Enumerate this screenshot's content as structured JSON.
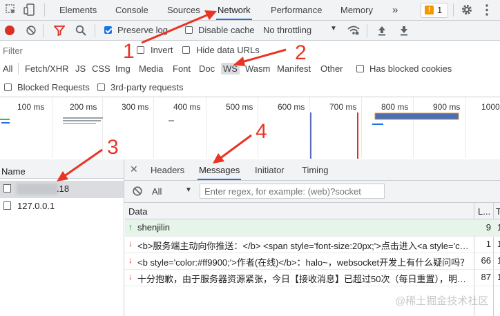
{
  "tabs": [
    "Elements",
    "Console",
    "Sources",
    "Network",
    "Performance",
    "Memory"
  ],
  "more_tabs": "»",
  "warning_count": "1",
  "toolbar": {
    "preserve_log": "Preserve log",
    "disable_cache": "Disable cache",
    "throttling": "No throttling",
    "throttling_arrow": "▼"
  },
  "filter": {
    "placeholder": "Filter",
    "invert": "Invert",
    "hide_data_urls": "Hide data URLs"
  },
  "types": [
    "All",
    "Fetch/XHR",
    "JS",
    "CSS",
    "Img",
    "Media",
    "Font",
    "Doc",
    "WS",
    "Wasm",
    "Manifest",
    "Other"
  ],
  "has_blocked_cookies": "Has blocked cookies",
  "blocked_requests": "Blocked Requests",
  "third_party": "3rd-party requests",
  "timeline_ticks": [
    "100 ms",
    "200 ms",
    "300 ms",
    "400 ms",
    "500 ms",
    "600 ms",
    "700 ms",
    "800 ms",
    "900 ms",
    "1000"
  ],
  "requests": {
    "header": "Name",
    "items": [
      ".18",
      "127.0.0.1"
    ]
  },
  "detail_tabs": [
    "Headers",
    "Messages",
    "Initiator",
    "Timing"
  ],
  "messages_filter": {
    "option": "All",
    "arrow": "▼",
    "placeholder": "Enter regex, for example: (web)?socket"
  },
  "messages_table": {
    "headers": [
      "Data",
      "L...",
      "T"
    ],
    "rows": [
      {
        "dir": "↑",
        "data": "shenjilin",
        "len": "9",
        "t": "1"
      },
      {
        "dir": "↓",
        "data": "<b>服务端主动向你推送：</b> <span style='font-size:20px;'>点击进入<a style='color:#ff9900'>",
        "len": "1",
        "t": "1"
      },
      {
        "dir": "↓",
        "data": "<b style='color:#ff9900;'>作者(在线)</b>：halo~，websocket开发上有什么疑问吗？",
        "len": "66",
        "t": "1"
      },
      {
        "dir": "↓",
        "data": "十分抱歉，由于服务器资源紧张，今日【接收消息】已超过50次（每日重置），明日再来吧",
        "len": "87",
        "t": "1"
      }
    ]
  },
  "annotations": [
    "1",
    "2",
    "3",
    "4"
  ],
  "watermark": "@稀土掘金技术社区",
  "colors": {
    "accent": "#1a73e8",
    "record": "#d93025",
    "annotation": "#ea3323",
    "sent_row": "#e6f4ea"
  }
}
